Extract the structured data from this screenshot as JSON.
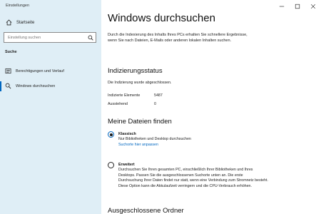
{
  "window": {
    "title": "Einstellungen",
    "minimize_label": "Minimieren",
    "maximize_label": "Maximieren",
    "close_label": "Schließen"
  },
  "sidebar": {
    "home_label": "Startseite",
    "search_placeholder": "Einstellung suchen",
    "section_label": "Suche",
    "items": [
      {
        "label": "Berechtigungen und Verlauf",
        "icon": "permissions-list-icon"
      },
      {
        "label": "Windows durchsuchen",
        "icon": "search-icon",
        "active": true
      }
    ]
  },
  "main": {
    "title": "Windows durchsuchen",
    "intro": "Durch die Indexierung des Inhalts Ihres PCs erhalten Sie schnellere Ergebnisse, wenn Sie nach Dateien, E-Mails oder anderen lokalen Inhalten suchen.",
    "indexing": {
      "heading": "Indizierungsstatus",
      "status_text": "Die Indizierung wurde abgeschlossen.",
      "indexed_label": "Indizierte Elemente",
      "indexed_value": "5487",
      "pending_label": "Ausstehend",
      "pending_value": "0"
    },
    "find_files": {
      "heading": "Meine Dateien finden",
      "options": [
        {
          "title": "Klassisch",
          "description": "Nur Bibliotheken und Desktop durchsuchen",
          "link": "Suchorte hier anpassen",
          "checked": true
        },
        {
          "title": "Erweitert",
          "description": "Durchsuchen Sie Ihren gesamten PC, einschließlich Ihrer Bibliotheken und Ihres Desktops. Passen Sie die ausgeschlossenen Suchorte unten an. Die erste Durchsuchung Ihrer Daten findet nur statt, wenn eine Verbindung zum Stromnetz besteht. Diese Option kann die Akkulaufzeit verringern und die CPU-Verbrauch erhöhen.",
          "checked": false
        }
      ]
    },
    "excluded_heading": "Ausgeschlossene Ordner"
  }
}
